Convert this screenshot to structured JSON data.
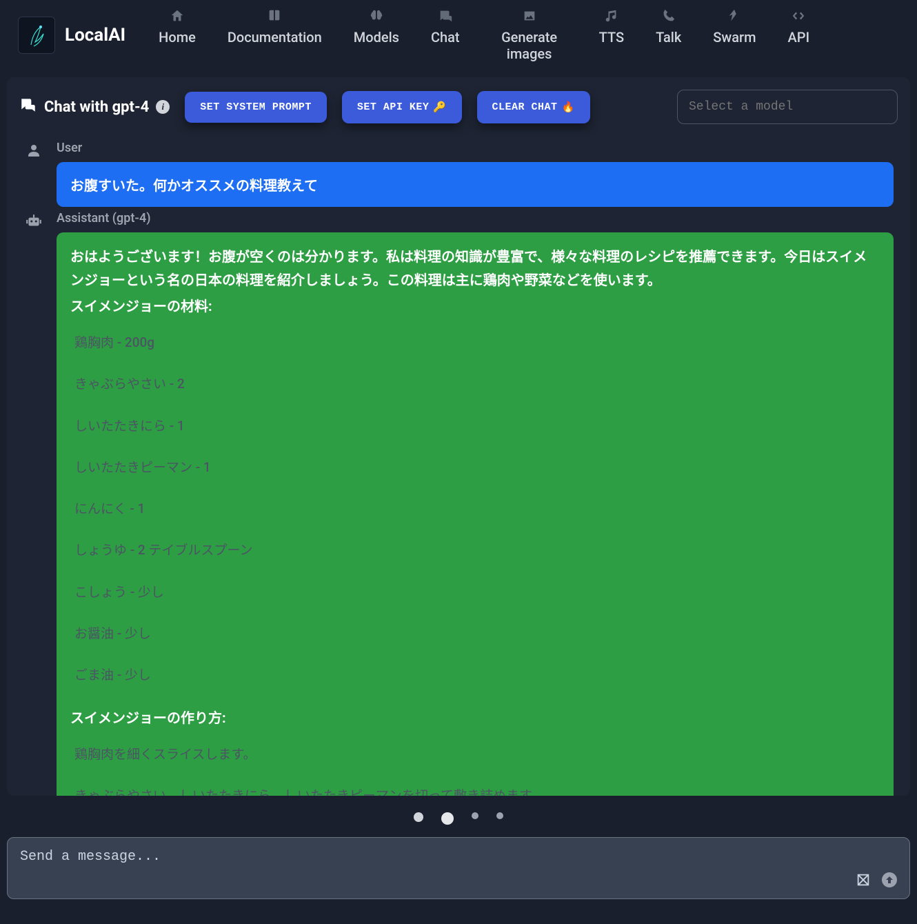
{
  "brand": {
    "name": "LocalAI"
  },
  "nav": [
    {
      "icon": "home",
      "label": "Home"
    },
    {
      "icon": "book",
      "label": "Documentation"
    },
    {
      "icon": "brain",
      "label": "Models"
    },
    {
      "icon": "chat",
      "label": "Chat"
    },
    {
      "icon": "image",
      "label": "Generate images"
    },
    {
      "icon": "music",
      "label": "TTS"
    },
    {
      "icon": "phone",
      "label": "Talk"
    },
    {
      "icon": "swarm",
      "label": "Swarm"
    },
    {
      "icon": "api",
      "label": "API"
    }
  ],
  "toolbar": {
    "title": "Chat with gpt-4",
    "set_system_prompt": "SET SYSTEM PROMPT",
    "set_api_key": "SET API KEY",
    "set_api_key_emoji": "🔑",
    "clear_chat": "CLEAR CHAT",
    "clear_chat_emoji": "🔥",
    "model_select_placeholder": "Select a model"
  },
  "chat": {
    "user_label": "User",
    "assistant_label": "Assistant (gpt-4)",
    "user_message": "お腹すいた。何かオススメの料理教えて",
    "assistant": {
      "intro": "おはようございます！お腹が空くのは分かります。私は料理の知識が豊富で、様々な料理のレシピを推薦できます。今日はスイメンジョーという名の日本の料理を紹介しましょう。この料理は主に鶏肉や野菜などを使います。",
      "ingredients_head": "スイメンジョーの材料:",
      "ingredients": [
        "鶏胸肉 - 200g",
        "きゃぶらやさい - 2",
        "しいたたきにら - 1",
        "しいたたきピーマン - 1",
        "にんにく - 1",
        "しょうゆ - 2 テイブルスプーン",
        "こしょう - 少し",
        "お醤油 - 少し",
        "ごま油 - 少し"
      ],
      "steps_head": "スイメンジョーの作り方:",
      "steps": [
        "鶏胸肉を細くスライスします。",
        "きゃぶらやさい、しいたたきにら、しいたたきピーマンを切って敷き詰めます。"
      ]
    }
  },
  "composer": {
    "placeholder": "Send a message..."
  }
}
